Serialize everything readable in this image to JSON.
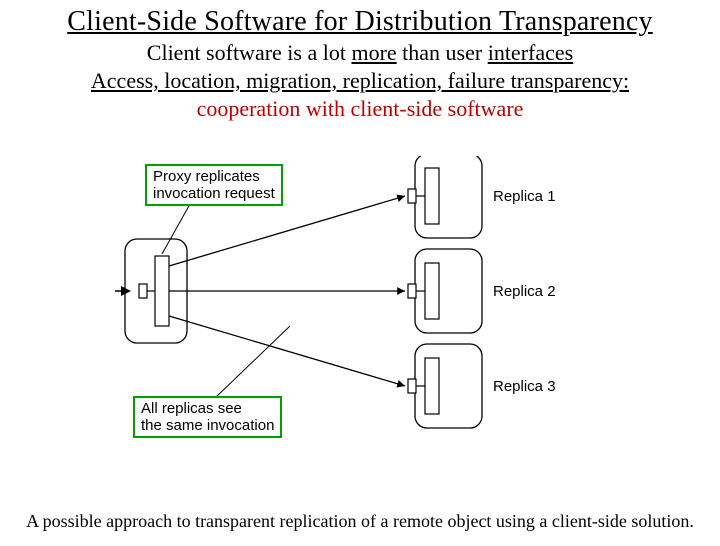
{
  "title": "Client-Side Software for Distribution Transparency",
  "line1_prefix": "Client software is a lot ",
  "line1_more": "more",
  "line1_mid": " than user ",
  "line1_ui": "interfaces",
  "line2": "Access, location, migration, replication, failure transparency:",
  "line3": "cooperation with client-side software",
  "diagram": {
    "proxy_note_l1": "Proxy replicates",
    "proxy_note_l2": "invocation request",
    "allsee_l1": "All replicas see",
    "allsee_l2": "the same invocation",
    "replica1": "Replica 1",
    "replica2": "Replica 2",
    "replica3": "Replica 3"
  },
  "caption": "A possible approach to transparent replication of a remote object using a client-side solution."
}
